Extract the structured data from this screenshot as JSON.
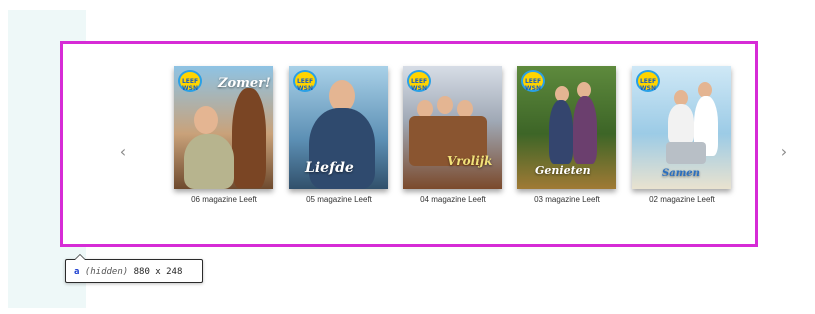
{
  "carousel": {
    "prev_icon": "chevron-left-icon",
    "next_icon": "chevron-right-icon",
    "prev_glyph": "‹",
    "next_glyph": "›",
    "items": [
      {
        "caption": "06 magazine Leeft",
        "logo_text": "LEEF WSN",
        "cover_title": "Zomer!",
        "theme": "#d98a3a"
      },
      {
        "caption": "05 magazine Leeft",
        "logo_text": "LEEF WSN",
        "cover_title": "Liefde",
        "theme": "#3d7fa8"
      },
      {
        "caption": "04 magazine Leeft",
        "logo_text": "LEEF WSN",
        "cover_title": "Vrolijk",
        "theme": "#8c5a3a"
      },
      {
        "caption": "03 magazine Leeft",
        "logo_text": "LEEF WSN",
        "cover_title": "Genieten",
        "theme": "#3f6a2e"
      },
      {
        "caption": "02 magazine Leeft",
        "logo_text": "LEEF WSN",
        "cover_title": "Samen",
        "theme": "#8ec7e8"
      }
    ]
  },
  "tooltip": {
    "tag": "a",
    "state": "(hidden)",
    "size": "880 x 248"
  },
  "colors": {
    "highlight": "#d62bd6",
    "left_strip": "#eef8f8"
  }
}
